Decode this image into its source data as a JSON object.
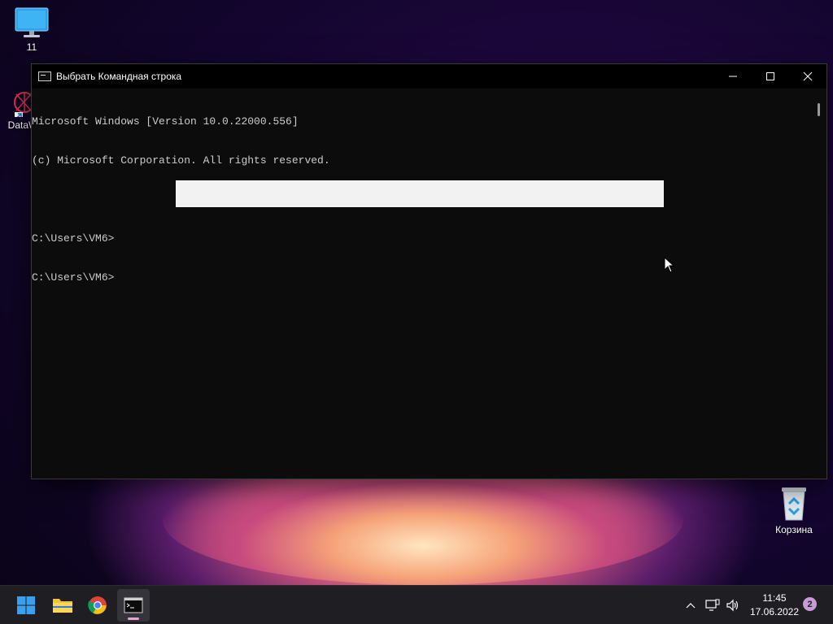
{
  "desktop": {
    "icons": [
      {
        "label": "11",
        "icon": "monitor-icon"
      },
      {
        "label": "DataW",
        "icon": "datawrapper-shortcut-icon"
      },
      {
        "label": "Корзина",
        "icon": "recycle-bin-icon"
      }
    ]
  },
  "window": {
    "title": "Выбрать Командная строка",
    "controls": {
      "minimize": "minimize-icon",
      "maximize": "maximize-icon",
      "close": "close-icon"
    },
    "console_lines": [
      "Microsoft Windows [Version 10.0.22000.556]",
      "(c) Microsoft Corporation. All rights reserved.",
      "",
      "C:\\Users\\VM6>",
      "C:\\Users\\VM6>"
    ]
  },
  "taskbar": {
    "apps": [
      {
        "name": "start",
        "icon": "windows-logo-icon"
      },
      {
        "name": "file-explorer",
        "icon": "folder-icon"
      },
      {
        "name": "chrome",
        "icon": "chrome-icon"
      },
      {
        "name": "command-prompt",
        "icon": "terminal-icon",
        "active": true
      }
    ],
    "tray": {
      "chevron": "chevron-up-icon",
      "network": "network-icon",
      "volume": "volume-icon"
    },
    "time": "11:45",
    "date": "17.06.2022",
    "notification_count": "2"
  },
  "colors": {
    "console_bg": "#0c0c0c",
    "console_text": "#cccccc",
    "taskbar_bg": "#1f1f23",
    "accent": "#0078d4"
  }
}
